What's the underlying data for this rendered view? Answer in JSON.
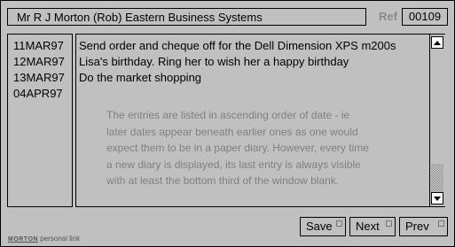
{
  "header": {
    "title": "Mr R J Morton (Rob)  Eastern Business Systems",
    "ref_label": "Ref",
    "ref_value": "00109"
  },
  "dates": [
    "11MAR97",
    "12MAR97",
    "13MAR97",
    "04APR97"
  ],
  "entries": [
    "Send order and cheque off for the Dell Dimension XPS m200s",
    "Lisa's birthday. Ring her to wish her a happy birthday",
    "Do the market shopping",
    ""
  ],
  "note": "The entries are listed in ascending order of date - ie later dates appear beneath earlier ones as one would expect them to be in a paper diary. However, every time a new diary is displayed, its last entry is always visible with at least the bottom third of the window blank.",
  "buttons": {
    "save": "Save",
    "next": "Next",
    "prev": "Prev"
  },
  "scrollbar": {
    "up_icon": "triangle-up",
    "down_icon": "triangle-down"
  },
  "logo": {
    "brand": "MORTON",
    "text": "personal link"
  }
}
